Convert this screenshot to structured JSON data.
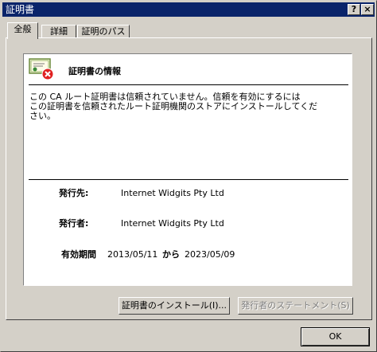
{
  "window": {
    "title": "証明書"
  },
  "titlebar_buttons": {
    "help": "?",
    "close": "×"
  },
  "tabs": [
    {
      "label": "全般"
    },
    {
      "label": "詳細"
    },
    {
      "label": "証明のパス"
    }
  ],
  "info": {
    "heading": "証明書の情報",
    "warning_line1": "この CA ルート証明書は信頼されていません。信頼を有効にするには",
    "warning_line2": "この証明書を信頼されたルート証明機関のストアにインストールしてくだ",
    "warning_line3": "さい。"
  },
  "details": {
    "issued_to_label": "発行先:",
    "issued_to_value": "Internet Widgits Pty Ltd",
    "issued_by_label": "発行者:",
    "issued_by_value": "Internet Widgits Pty Ltd",
    "validity_label": "有効期間",
    "valid_from": "2013/05/11",
    "to_word": "から",
    "valid_to": "2023/05/09"
  },
  "buttons": {
    "install": "証明書のインストール(I)...",
    "issuer_statement": "発行者のステートメント(S)",
    "ok": "OK"
  }
}
